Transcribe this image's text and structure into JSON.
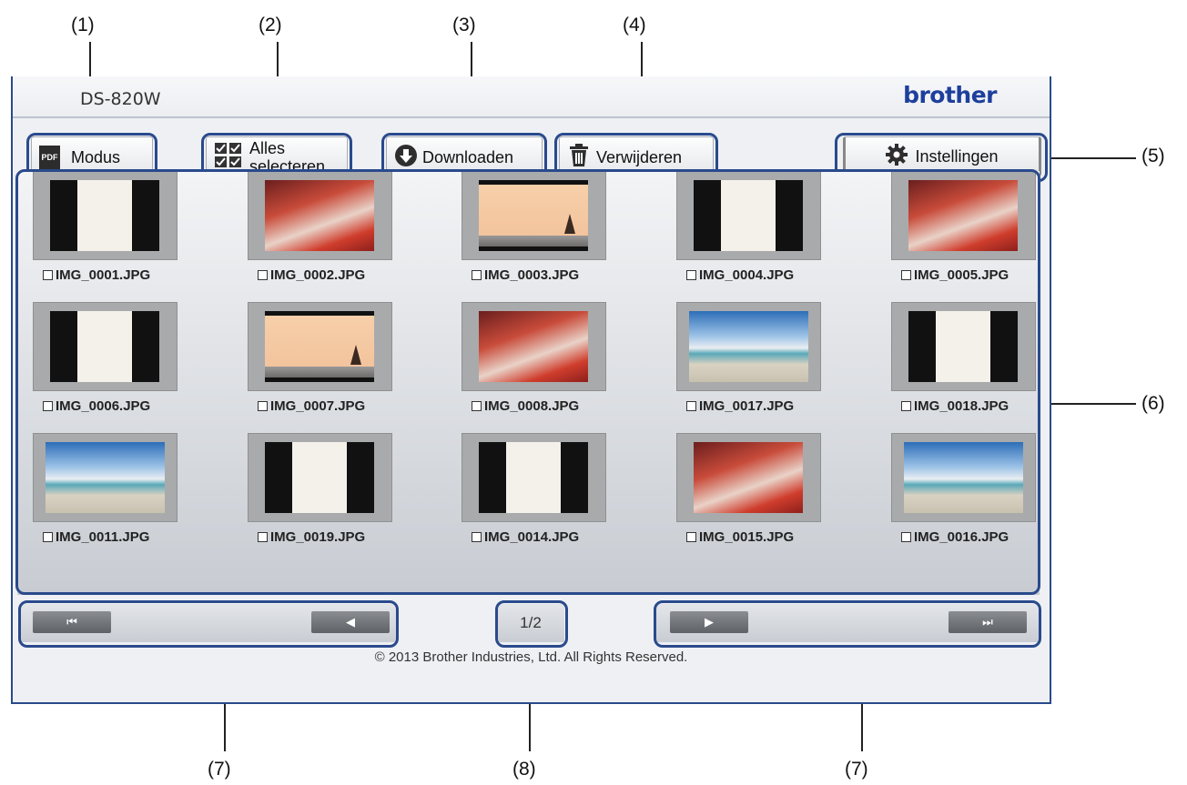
{
  "callouts": {
    "c1": "(1)",
    "c2": "(2)",
    "c3": "(3)",
    "c4": "(4)",
    "c5": "(5)",
    "c6": "(6)",
    "c7a": "(7)",
    "c7b": "(7)",
    "c8": "(8)"
  },
  "header": {
    "model": "DS-820W",
    "brand": "brother"
  },
  "toolbar": {
    "mode_icon_text": "PDF",
    "mode_label": "Modus",
    "select_all_label_line1": "Alles",
    "select_all_label_line2": "selecteren",
    "download_label": "Downloaden",
    "delete_label": "Verwijderen",
    "settings_label": "Instellingen"
  },
  "files": [
    {
      "name": "IMG_0001.JPG",
      "type": "doc"
    },
    {
      "name": "IMG_0002.JPG",
      "type": "food"
    },
    {
      "name": "IMG_0003.JPG",
      "type": "sunset"
    },
    {
      "name": "IMG_0004.JPG",
      "type": "doc"
    },
    {
      "name": "IMG_0005.JPG",
      "type": "food"
    },
    {
      "name": "IMG_0006.JPG",
      "type": "doc"
    },
    {
      "name": "IMG_0007.JPG",
      "type": "sunset"
    },
    {
      "name": "IMG_0008.JPG",
      "type": "food"
    },
    {
      "name": "IMG_0017.JPG",
      "type": "beach"
    },
    {
      "name": "IMG_0018.JPG",
      "type": "doc"
    },
    {
      "name": "IMG_0011.JPG",
      "type": "beach"
    },
    {
      "name": "IMG_0019.JPG",
      "type": "doc"
    },
    {
      "name": "IMG_0014.JPG",
      "type": "doc"
    },
    {
      "name": "IMG_0015.JPG",
      "type": "food"
    },
    {
      "name": "IMG_0016.JPG",
      "type": "beach"
    }
  ],
  "pagination": {
    "first_glyph": "⏮",
    "prev_glyph": "◀",
    "next_glyph": "▶",
    "last_glyph": "⏭",
    "page_indicator": "1/2"
  },
  "footer": {
    "copyright": "© 2013 Brother Industries, Ltd. All Rights Reserved."
  },
  "colors": {
    "outline": "#2a4a8c",
    "brand": "#1d3f9c"
  }
}
